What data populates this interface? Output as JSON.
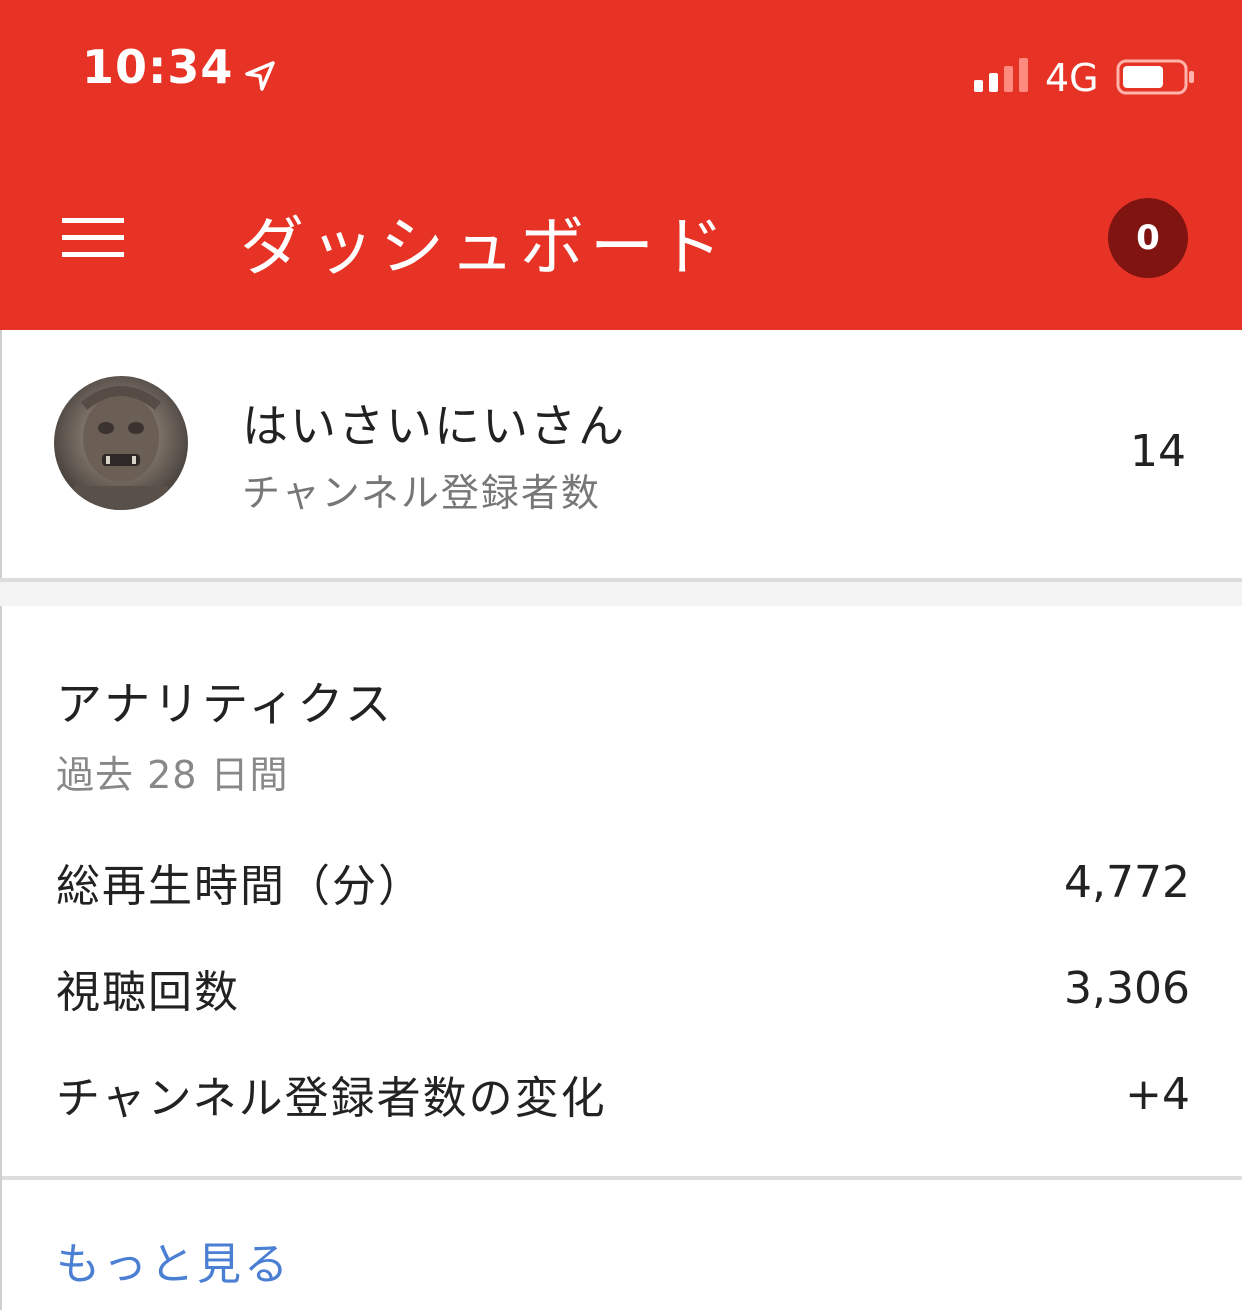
{
  "status_bar": {
    "time": "10:34",
    "network": "4G"
  },
  "app_bar": {
    "title": "ダッシュボード",
    "notification_count": "0"
  },
  "channel": {
    "name": "はいさいにいさん",
    "subscriber_label": "チャンネル登録者数",
    "subscriber_count": "14"
  },
  "analytics": {
    "title": "アナリティクス",
    "period": "過去 28 日間",
    "metrics": [
      {
        "label": "総再生時間（分）",
        "value": "4,772"
      },
      {
        "label": "視聴回数",
        "value": "3,306"
      },
      {
        "label": "チャンネル登録者数の変化",
        "value": "+4"
      }
    ],
    "more_link": "もっと見る"
  },
  "colors": {
    "header": "#e63325",
    "badge": "#7f1410",
    "link": "#4a7fd4"
  }
}
